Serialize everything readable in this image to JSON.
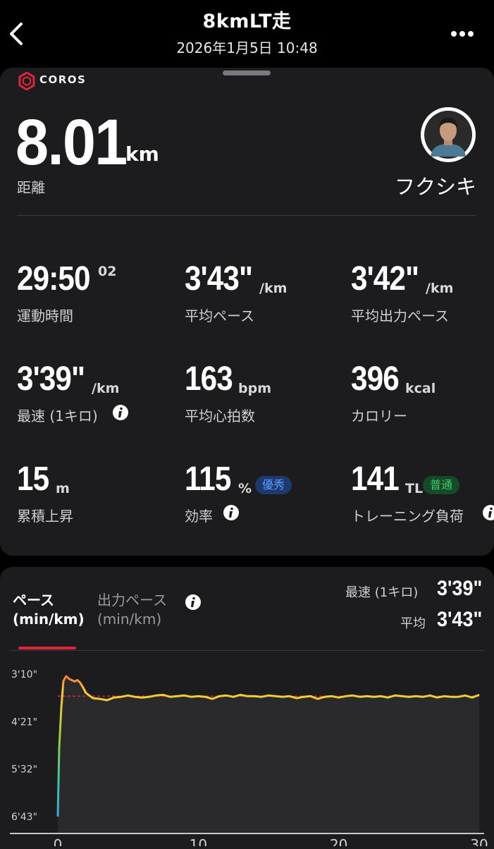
{
  "header": {
    "title": "8kmLT走",
    "subtitle": "2026年1月5日 10:48"
  },
  "brand": {
    "logo_text": "COROS"
  },
  "summary": {
    "distance_value": "8.01",
    "distance_unit": "km",
    "distance_label": "距離",
    "username": "フクシキ"
  },
  "stats": {
    "time": {
      "value": "29:50",
      "sub": "02",
      "label": "運動時間"
    },
    "avg_pace": {
      "value": "3'43\"",
      "unit": "/km",
      "label": "平均ペース"
    },
    "avg_power_pace": {
      "value": "3'42\"",
      "unit": "/km",
      "label": "平均出力ペース"
    },
    "fastest": {
      "value": "3'39\"",
      "unit": "/km",
      "label": "最速 (1キロ)"
    },
    "avg_hr": {
      "value": "163",
      "unit": "bpm",
      "label": "平均心拍数"
    },
    "calories": {
      "value": "396",
      "unit": "kcal",
      "label": "カロリー"
    },
    "ascent": {
      "value": "15",
      "unit": "m",
      "label": "累積上昇"
    },
    "efficiency": {
      "value": "115",
      "unit": "%",
      "badge": "優秀",
      "label": "効率"
    },
    "training_load": {
      "value": "141",
      "unit": "TL",
      "badge": "普通",
      "label": "トレーニング負荷"
    }
  },
  "chart_section": {
    "tab_pace": {
      "line1": "ペース",
      "line2": "(min/km)"
    },
    "tab_power": {
      "line1": "出力ペース",
      "line2": "(min/km)"
    },
    "best_label": "最速 (1キロ)",
    "best_value": "3'39\"",
    "avg_label": "平均",
    "avg_value": "3'43\""
  },
  "colors": {
    "accent_red": "#e0243a",
    "badge_blue": "#5b9cff",
    "badge_green": "#3ccc66",
    "line_orange": "#ff7a3a",
    "line_yellow": "#ffcc33"
  },
  "chart_data": {
    "type": "line",
    "xlabel": "",
    "ylabel": "",
    "y_tick_labels": [
      "3'10\"",
      "4'21\"",
      "5'32\"",
      "6'43\""
    ],
    "y_ticks_sec": [
      190,
      261,
      332,
      403
    ],
    "x_tick_labels": [
      "0",
      "10",
      "20",
      "30"
    ],
    "x_ticks": [
      0,
      10,
      20,
      30
    ],
    "xlim": [
      0,
      30
    ],
    "ylim_sec": [
      190,
      403
    ],
    "avg_sec": 223,
    "series": [
      {
        "x": [
          0,
          0.1,
          0.25,
          0.4,
          0.6,
          0.8,
          1.0,
          1.2,
          1.4,
          1.6,
          1.8,
          2.0,
          2.5,
          3.0,
          3.5,
          4.0,
          4.5,
          5.0,
          5.5,
          6.0,
          6.5,
          7.0,
          7.5,
          8.0,
          8.5,
          9.0,
          9.5,
          10.0,
          10.5,
          11.0,
          11.5,
          12.0,
          12.5,
          13.0,
          13.5,
          14.0,
          14.5,
          15.0,
          15.5,
          16.0,
          16.5,
          17.0,
          17.5,
          18.0,
          18.5,
          19.0,
          19.5,
          20.0,
          20.5,
          21.0,
          21.5,
          22.0,
          22.5,
          23.0,
          23.5,
          24.0,
          24.5,
          25.0,
          25.5,
          26.0,
          26.5,
          27.0,
          27.5,
          28.0,
          28.5,
          29.0,
          29.5,
          30.0
        ],
        "y": [
          403,
          300,
          240,
          200,
          193,
          197,
          199,
          201,
          199,
          203,
          210,
          218,
          226,
          227,
          229,
          225,
          224,
          222,
          224,
          225,
          224,
          222,
          221,
          224,
          223,
          222,
          224,
          223,
          224,
          227,
          223,
          222,
          224,
          221,
          223,
          223,
          224,
          222,
          223,
          224,
          223,
          226,
          224,
          223,
          227,
          224,
          223,
          225,
          223,
          222,
          224,
          223,
          224,
          223,
          225,
          222,
          223,
          224,
          223,
          224,
          222,
          225,
          223,
          224,
          224,
          222,
          225,
          221
        ]
      }
    ]
  }
}
